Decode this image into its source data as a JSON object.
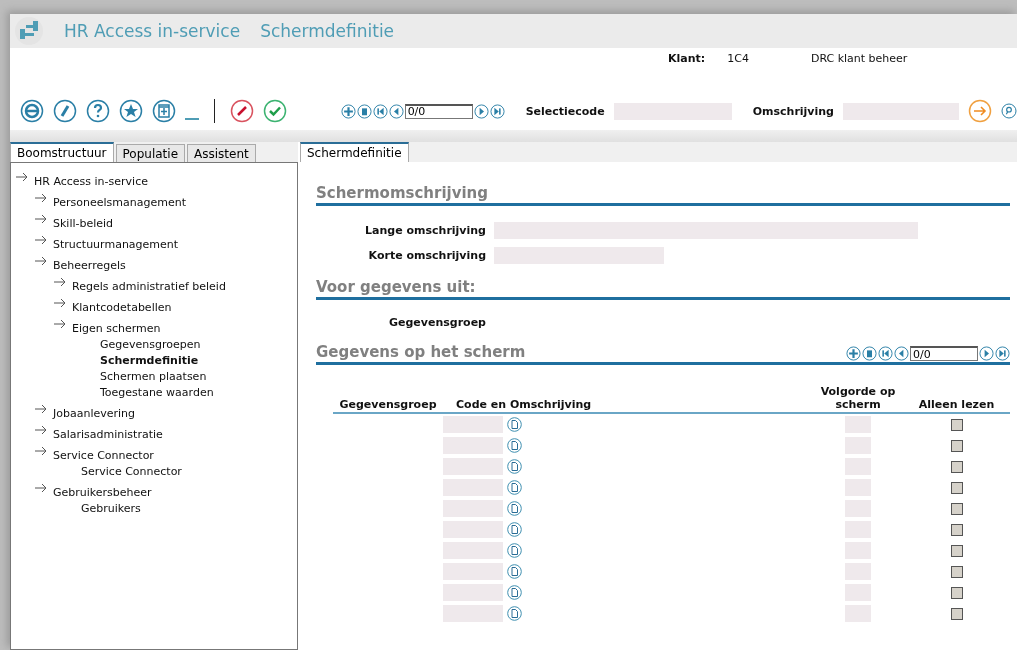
{
  "window": {
    "app_title": "HR Access in-service",
    "screen_title": "Schermdefinitie"
  },
  "client": {
    "label": "Klant:",
    "code": "1C4",
    "name": "DRC klant beheer"
  },
  "toolbar": {
    "pager": {
      "value": "0/0"
    },
    "filters": [
      {
        "label": "Selectiecode"
      },
      {
        "label": "Omschrijving"
      }
    ]
  },
  "left_tabs": [
    {
      "label": "Boomstructuur",
      "selected": true
    },
    {
      "label": "Populatie",
      "selected": false
    },
    {
      "label": "Assistent",
      "selected": false
    }
  ],
  "tree": [
    {
      "label": "HR Access in-service",
      "kind": "folder",
      "selected": false,
      "children": [
        {
          "label": "Personeelsmanagement",
          "kind": "folder",
          "selected": false
        },
        {
          "label": "Skill-beleid",
          "kind": "folder",
          "selected": false
        },
        {
          "label": "Structuurmanagement",
          "kind": "folder",
          "selected": false
        },
        {
          "label": "Beheerregels",
          "kind": "folder",
          "selected": false,
          "children": [
            {
              "label": "Regels administratief beleid",
              "kind": "folder",
              "selected": false
            },
            {
              "label": "Klantcodetabellen",
              "kind": "folder",
              "selected": false
            },
            {
              "label": "Eigen schermen",
              "kind": "folder",
              "selected": false,
              "children": [
                {
                  "label": "Gegevensgroepen",
                  "kind": "leaf",
                  "selected": false
                },
                {
                  "label": "Schermdefinitie",
                  "kind": "leaf",
                  "selected": true
                },
                {
                  "label": "Schermen plaatsen",
                  "kind": "leaf",
                  "selected": false
                },
                {
                  "label": "Toegestane waarden",
                  "kind": "leaf",
                  "selected": false
                }
              ]
            }
          ]
        },
        {
          "label": "Jobaanlevering",
          "kind": "folder",
          "selected": false
        },
        {
          "label": "Salarisadministratie",
          "kind": "folder",
          "selected": false
        },
        {
          "label": "Service Connector",
          "kind": "folder",
          "selected": false,
          "children": [
            {
              "label": "Service Connector",
              "kind": "leaf",
              "selected": false
            }
          ]
        },
        {
          "label": "Gebruikersbeheer",
          "kind": "folder",
          "selected": false,
          "children": [
            {
              "label": "Gebruikers",
              "kind": "leaf",
              "selected": false
            }
          ]
        }
      ]
    }
  ],
  "right_tabs": [
    {
      "label": "Schermdefinitie",
      "selected": true
    }
  ],
  "sections": [
    {
      "title": "Schermomschrijving",
      "fields": [
        {
          "label": "Lange omschrijving",
          "kind": "long"
        },
        {
          "label": "Korte omschrijving",
          "kind": "short"
        }
      ]
    },
    {
      "title": "Voor gegevens uit:",
      "fields": [
        {
          "label": "Gegevensgroep",
          "kind": "label"
        }
      ]
    }
  ],
  "grid": {
    "title": "Gegevens op het scherm",
    "pager": {
      "value": "0/0"
    },
    "columns": [
      "Gegevensgroep",
      "Code en Omschrijving",
      "Volgorde op scherm",
      "Alleen lezen"
    ],
    "rows": [
      {
        "read_only": false
      },
      {
        "read_only": false
      },
      {
        "read_only": false
      },
      {
        "read_only": false
      },
      {
        "read_only": false
      },
      {
        "read_only": false
      },
      {
        "read_only": false
      },
      {
        "read_only": false
      },
      {
        "read_only": false
      },
      {
        "read_only": false
      }
    ]
  }
}
